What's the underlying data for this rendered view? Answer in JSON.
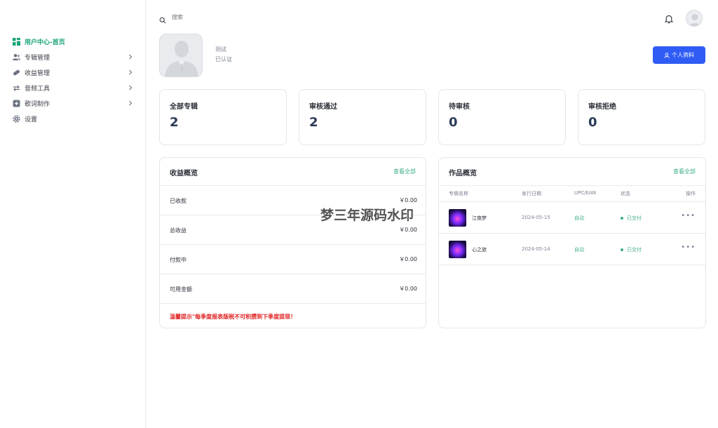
{
  "sidebar": {
    "items": [
      {
        "label": "用户中心-首页",
        "icon": "dashboard-icon",
        "active": true,
        "has_chevron": false
      },
      {
        "label": "专辑管理",
        "icon": "users-icon",
        "active": false,
        "has_chevron": true
      },
      {
        "label": "收益管理",
        "icon": "pill-icon",
        "active": false,
        "has_chevron": true
      },
      {
        "label": "音频工具",
        "icon": "repeat-icon",
        "active": false,
        "has_chevron": true
      },
      {
        "label": "歌词制作",
        "icon": "plus-square-icon",
        "active": false,
        "has_chevron": true
      },
      {
        "label": "设置",
        "icon": "gear-icon",
        "active": false,
        "has_chevron": false
      }
    ]
  },
  "topbar": {
    "search_placeholder": "搜索"
  },
  "profile": {
    "name": "测试",
    "status": "已认证",
    "button_label": "个人资料"
  },
  "stats": [
    {
      "title": "全部专辑",
      "value": "2"
    },
    {
      "title": "审核通过",
      "value": "2"
    },
    {
      "title": "待审核",
      "value": "0"
    },
    {
      "title": "审核拒绝",
      "value": "0"
    }
  ],
  "income": {
    "title": "收益概览",
    "view_all": "查看全部",
    "rows": [
      {
        "label": "已收款",
        "value": "￥0.00"
      },
      {
        "label": "总收益",
        "value": "￥0.00"
      },
      {
        "label": "付款中",
        "value": "￥0.00"
      },
      {
        "label": "可用金额",
        "value": "￥0.00"
      }
    ],
    "tip": "温馨提示\"每季度报表版税不可积攒到下季度提现！"
  },
  "works": {
    "title": "作品概览",
    "view_all": "查看全部",
    "columns": [
      "专辑名称",
      "发行日期",
      "UPC/EAN",
      "状态",
      "操作"
    ],
    "rows": [
      {
        "name": "江南梦",
        "date": "2024-05-15",
        "upc": "自动",
        "status": "已交付"
      },
      {
        "name": "心之旅",
        "date": "2024-05-14",
        "upc": "自动",
        "status": "已交付"
      }
    ]
  },
  "watermark": "梦三年源码水印",
  "colors": {
    "accent_green": "#1aa37a",
    "primary_blue": "#2f5cf5",
    "warning_red": "#e02020"
  }
}
